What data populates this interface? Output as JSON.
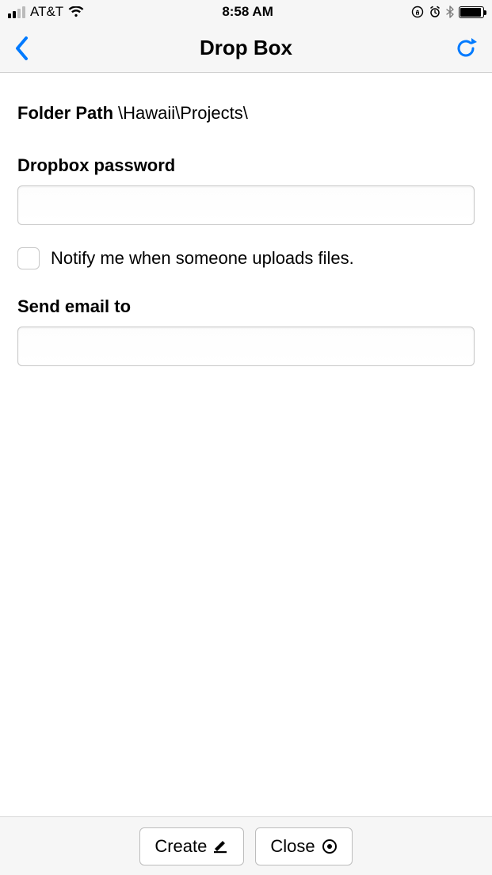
{
  "status": {
    "carrier": "AT&T",
    "time": "8:58 AM"
  },
  "nav": {
    "title": "Drop Box"
  },
  "form": {
    "folder_label": "Folder Path",
    "folder_path": "\\Hawaii\\Projects\\",
    "password_label": "Dropbox password",
    "password_value": "",
    "notify_label": "Notify me when someone uploads files.",
    "notify_checked": false,
    "email_label": "Send email to",
    "email_value": ""
  },
  "footer": {
    "create_label": "Create",
    "close_label": "Close"
  },
  "colors": {
    "ios_blue": "#007aff"
  }
}
